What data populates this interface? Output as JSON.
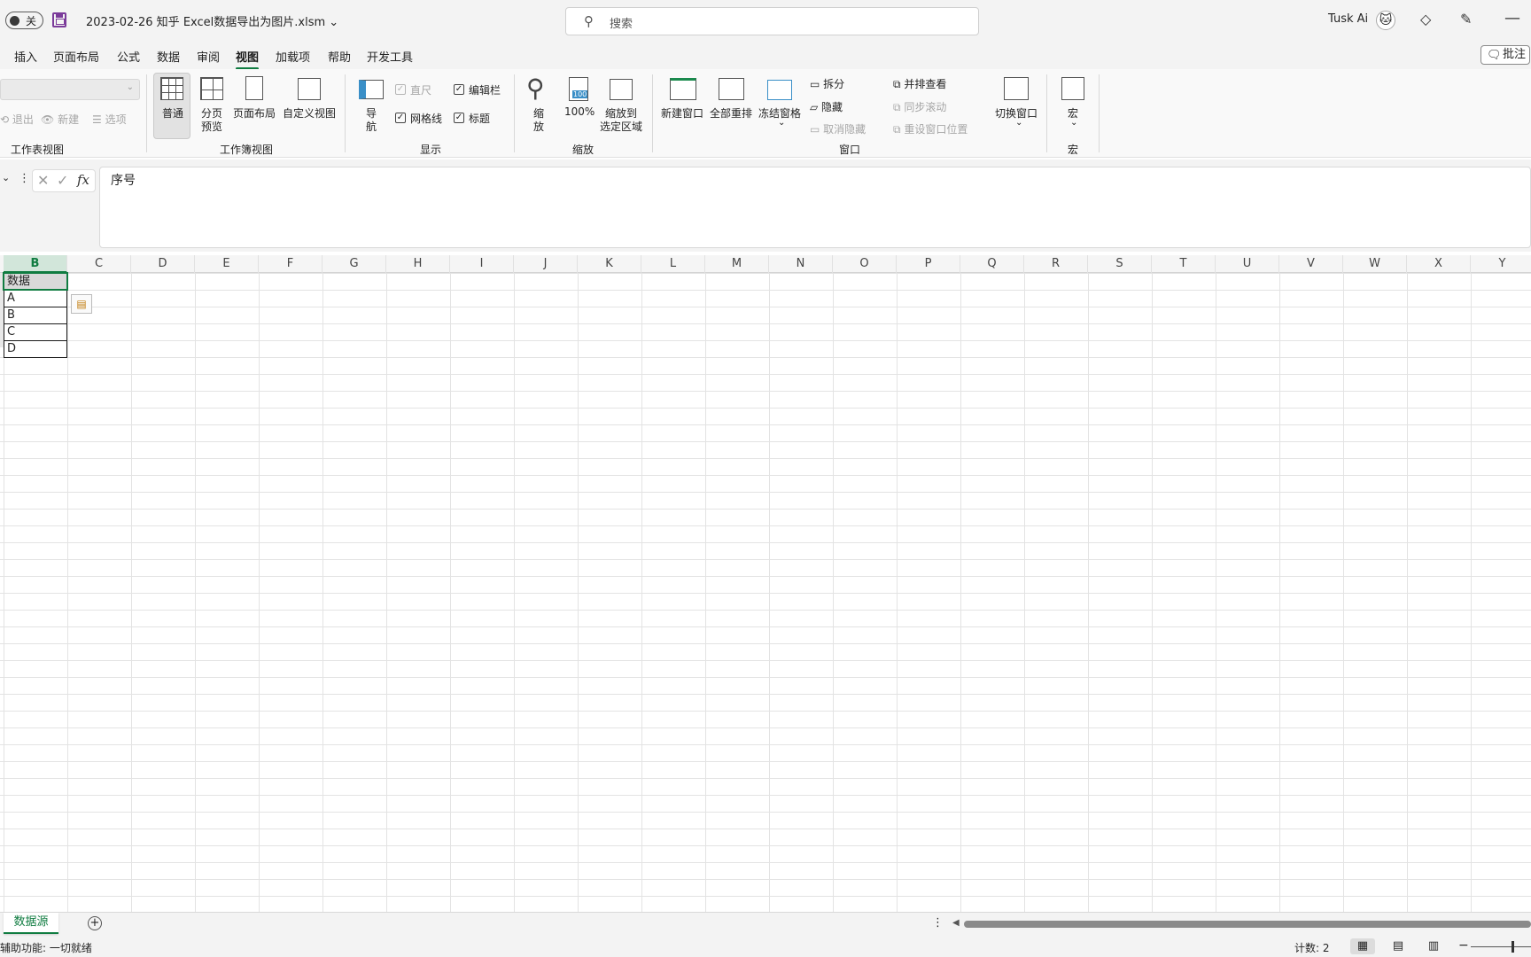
{
  "titlebar": {
    "autosave_label": "关",
    "document_title": "2023-02-26 知乎 Excel数据导出为图片.xlsm ⌄",
    "search_placeholder": "搜索",
    "user_name": "Tusk Ai"
  },
  "menu": {
    "tabs": [
      "插入",
      "页面布局",
      "公式",
      "数据",
      "审阅",
      "视图",
      "加载项",
      "帮助",
      "开发工具"
    ],
    "active_tab": "视图",
    "comment_label": "批注"
  },
  "ribbon": {
    "sheet_view": {
      "exit": "退出",
      "new": "新建",
      "options": "选项",
      "group": "工作表视图"
    },
    "workbook_views": {
      "normal": "普通",
      "page_break_1": "分页",
      "page_break_2": "预览",
      "page_layout": "页面布局",
      "custom_views": "自定义视图",
      "group": "工作簿视图"
    },
    "show": {
      "nav_1": "导",
      "nav_2": "航",
      "ruler": "直尺",
      "formula_bar": "编辑栏",
      "gridlines": "网格线",
      "headings": "标题",
      "group": "显示",
      "checks": {
        "ruler": false,
        "formula_bar": true,
        "gridlines": true,
        "headings": true
      }
    },
    "zoom": {
      "zoom_1": "缩",
      "zoom_2": "放",
      "hundred": "100%",
      "hundred_icon": "100",
      "to_sel_1": "缩放到",
      "to_sel_2": "选定区域",
      "group": "缩放"
    },
    "window": {
      "new_window": "新建窗口",
      "arrange_all": "全部重排",
      "freeze_panes": "冻结窗格",
      "split": "拆分",
      "hide": "隐藏",
      "unhide": "取消隐藏",
      "side_by_side": "并排查看",
      "sync_scroll": "同步滚动",
      "reset_pos": "重设窗口位置",
      "switch_windows": "切换窗口",
      "group": "窗口"
    },
    "macros": {
      "macros": "宏",
      "group": "宏"
    }
  },
  "formula_bar": {
    "content": "序号"
  },
  "grid": {
    "columns": [
      "B",
      "C",
      "D",
      "E",
      "F",
      "G",
      "H",
      "I",
      "J",
      "K",
      "L",
      "M",
      "N",
      "O",
      "P",
      "Q",
      "R",
      "S",
      "T",
      "U",
      "V",
      "W",
      "X",
      "Y"
    ],
    "selected_column": "B",
    "cells": [
      "数据",
      "A",
      "B",
      "C",
      "D"
    ]
  },
  "sheets": {
    "tabs": [
      "数据源"
    ]
  },
  "status": {
    "accessibility": "辅助功能: 一切就绪",
    "count": "计数: 2"
  },
  "colors": {
    "accent": "#107c41",
    "save_icon": "#7b3b9a"
  }
}
